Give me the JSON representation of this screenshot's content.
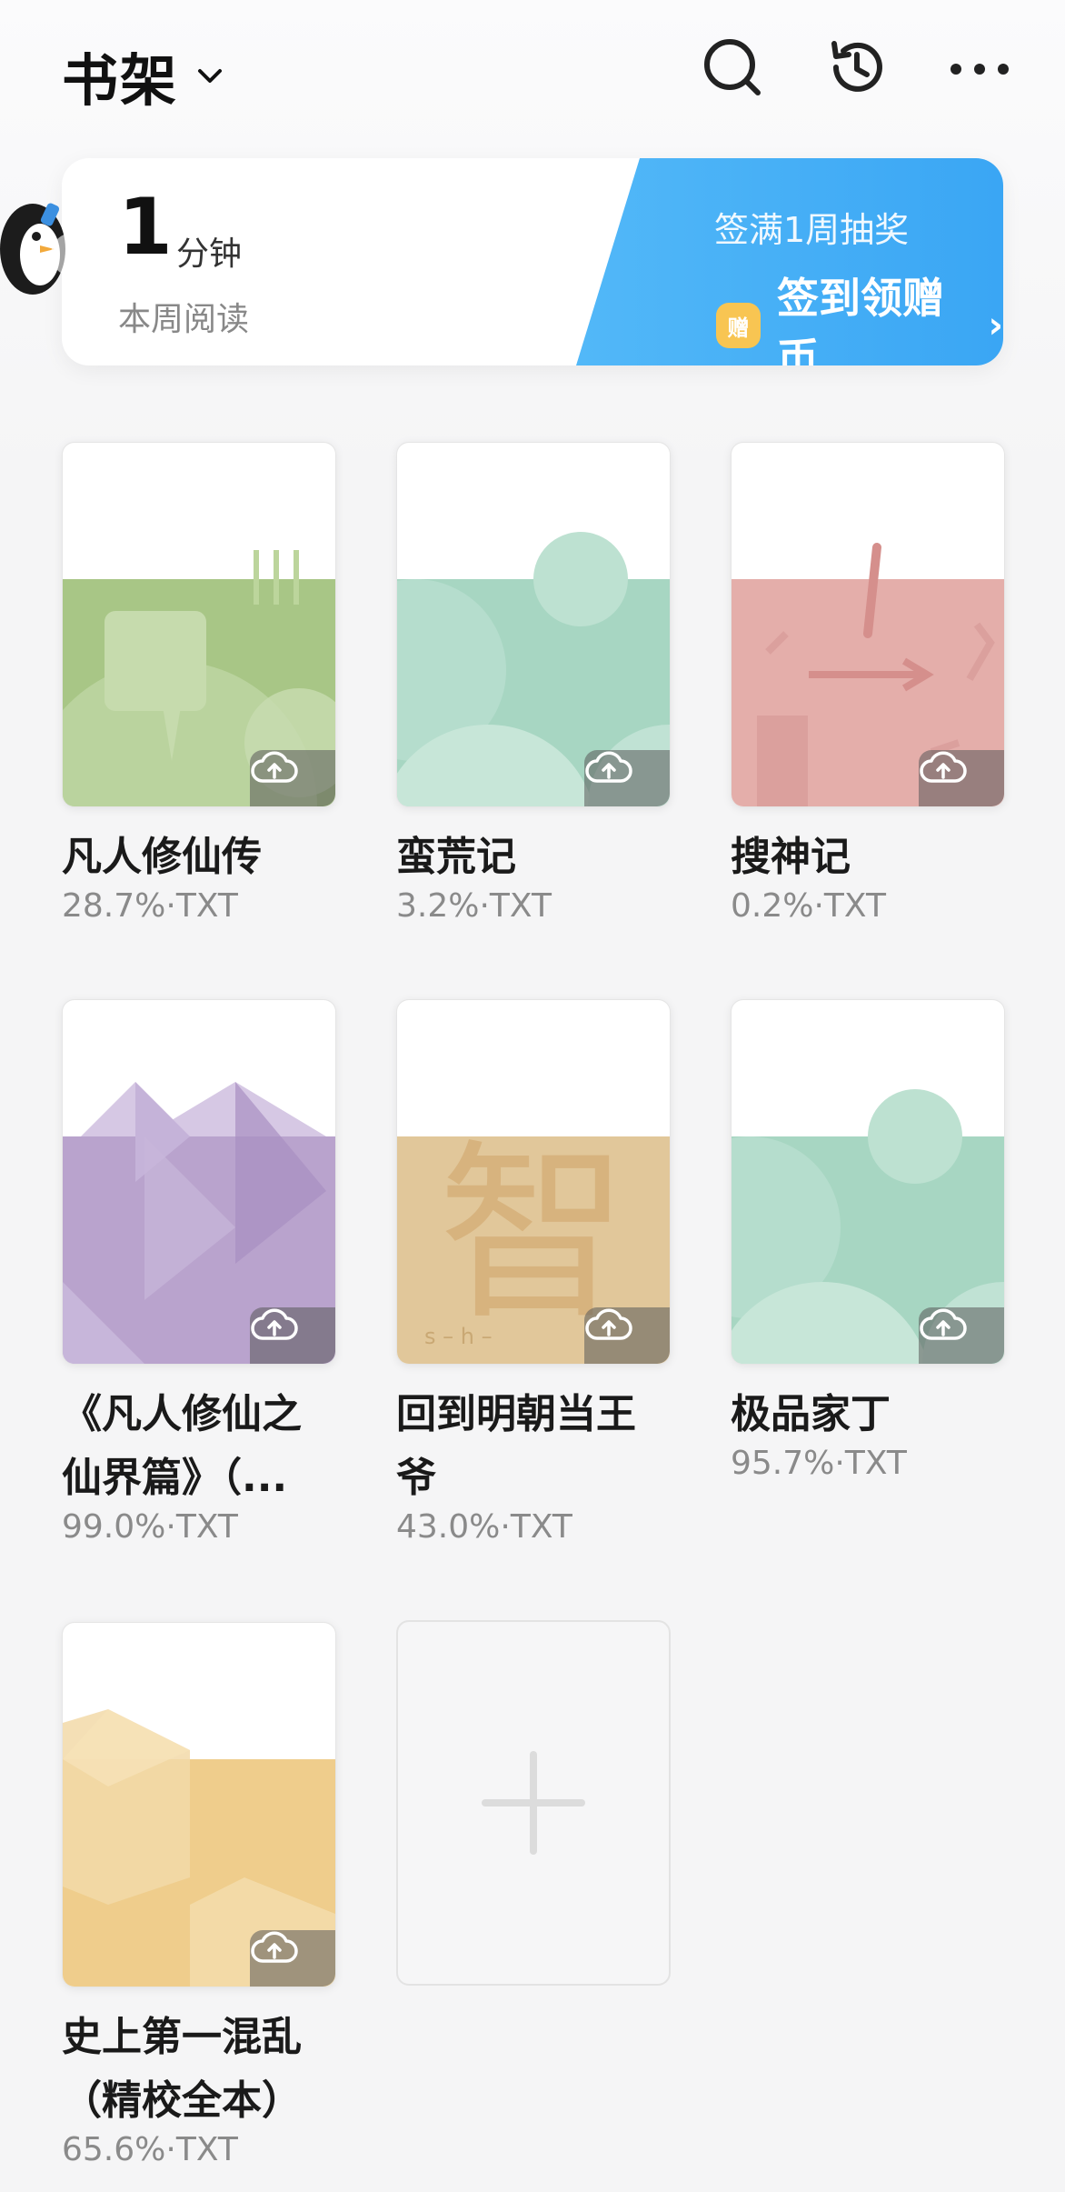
{
  "header": {
    "title": "书架"
  },
  "reading_card": {
    "minutes": "1",
    "unit": "分钟",
    "label": "本周阅读",
    "promo_top": "签满1周抽奖",
    "promo_main": "签到领赠币",
    "coin_glyph": "赠"
  },
  "books": [
    {
      "title": "凡人修仙传",
      "progress": "28.7%",
      "format": "TXT",
      "cover_color": "#a8c686"
    },
    {
      "title": "蛮荒记",
      "progress": "3.2%",
      "format": "TXT",
      "cover_color": "#a7d6c2"
    },
    {
      "title": "搜神记",
      "progress": "0.2%",
      "format": "TXT",
      "cover_color": "#e4aeaa"
    },
    {
      "title": "《凡人修仙之仙界篇》（...",
      "progress": "99.0%",
      "format": "TXT",
      "cover_color": "#b9a3cd"
    },
    {
      "title": "回到明朝当王爷",
      "progress": "43.0%",
      "format": "TXT",
      "cover_color": "#e1c79a"
    },
    {
      "title": "极品家丁",
      "progress": "95.7%",
      "format": "TXT",
      "cover_color": "#a7d6c2"
    },
    {
      "title": "史上第一混乱（精校全本）",
      "progress": "65.6%",
      "format": "TXT",
      "cover_color": "#efcd8c"
    }
  ],
  "cover_char": "智",
  "cover_char_pinyin": "s – h –"
}
